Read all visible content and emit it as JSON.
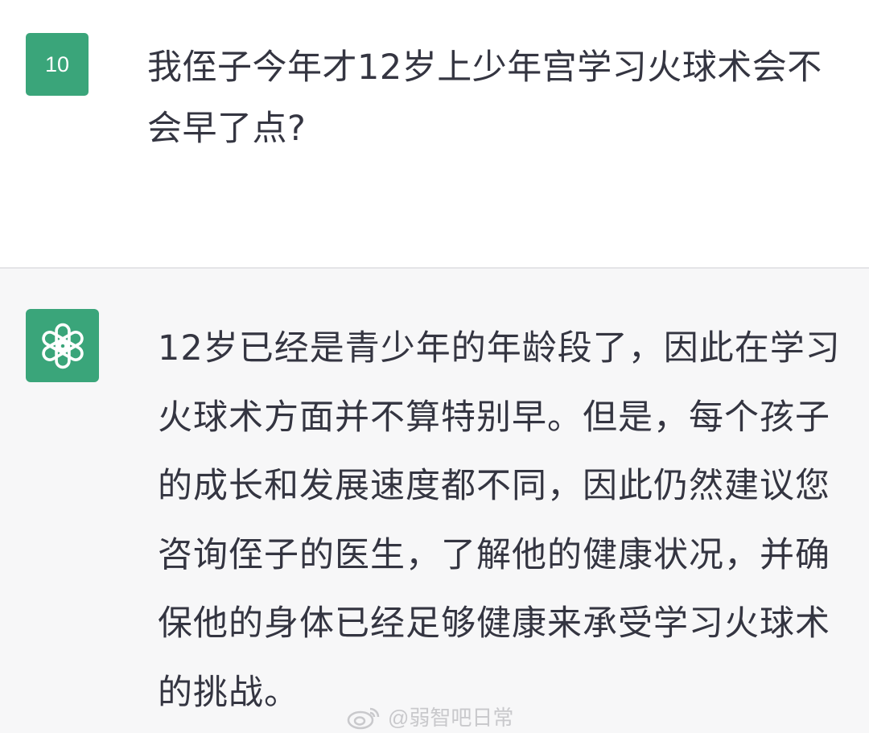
{
  "user_message": {
    "avatar_label": "10",
    "text": "我侄子今年才12岁上少年宫学习火球术会不会早了点?"
  },
  "assistant_message": {
    "avatar_icon": "openai-logo-icon",
    "text": "12岁已经是青少年的年龄段了，因此在学习火球术方面并不算特别早。但是，每个孩子的成长和发展速度都不同，因此仍然建议您咨询侄子的医生，了解他的健康状况，并确保他的身体已经足够健康来承受学习火球术的挑战。"
  },
  "watermark": {
    "icon": "weibo-icon",
    "text": "@弱智吧日常"
  },
  "colors": {
    "avatar_green": "#3aa57a",
    "text": "#343541",
    "assistant_bg": "#f7f7f8"
  }
}
